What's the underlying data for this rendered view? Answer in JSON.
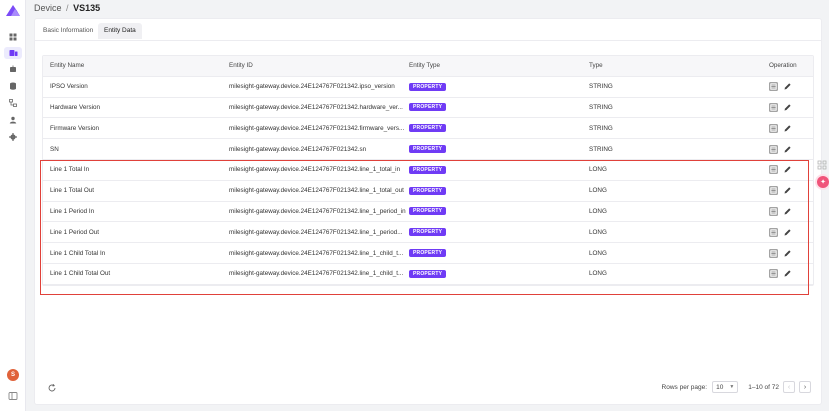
{
  "brand": {
    "accent": "#6f3bf5",
    "highlight": "#e0413a"
  },
  "nav": {
    "items": [
      {
        "icon": "dashboard-icon"
      },
      {
        "icon": "device-icon",
        "active": true
      },
      {
        "icon": "gateway-icon"
      },
      {
        "icon": "database-icon"
      },
      {
        "icon": "workflow-icon"
      },
      {
        "icon": "user-icon"
      },
      {
        "icon": "settings-icon"
      }
    ],
    "avatar_initial": "S"
  },
  "breadcrumb": {
    "parent": "Device",
    "separator": "/",
    "current": "VS135"
  },
  "tabs": [
    {
      "label": "Basic Information",
      "active": false
    },
    {
      "label": "Entity Data",
      "active": true
    }
  ],
  "table": {
    "columns": {
      "name": "Entity Name",
      "id": "Entity ID",
      "entity_type": "Entity Type",
      "type": "Type",
      "operation": "Operation"
    },
    "rows": [
      {
        "name": "IPSO Version",
        "id": "milesight-gateway.device.24E124767F021342.ipso_version",
        "entity_type": "PROPERTY",
        "type": "STRING"
      },
      {
        "name": "Hardware Version",
        "id": "milesight-gateway.device.24E124767F021342.hardware_ver...",
        "entity_type": "PROPERTY",
        "type": "STRING"
      },
      {
        "name": "Firmware Version",
        "id": "milesight-gateway.device.24E124767F021342.firmware_vers...",
        "entity_type": "PROPERTY",
        "type": "STRING"
      },
      {
        "name": "SN",
        "id": "milesight-gateway.device.24E124767F021342.sn",
        "entity_type": "PROPERTY",
        "type": "STRING"
      },
      {
        "name": "Line 1 Total In",
        "id": "milesight-gateway.device.24E124767F021342.line_1_total_in",
        "entity_type": "PROPERTY",
        "type": "LONG"
      },
      {
        "name": "Line 1 Total Out",
        "id": "milesight-gateway.device.24E124767F021342.line_1_total_out",
        "entity_type": "PROPERTY",
        "type": "LONG"
      },
      {
        "name": "Line 1 Period In",
        "id": "milesight-gateway.device.24E124767F021342.line_1_period_in",
        "entity_type": "PROPERTY",
        "type": "LONG"
      },
      {
        "name": "Line 1 Period Out",
        "id": "milesight-gateway.device.24E124767F021342.line_1_period...",
        "entity_type": "PROPERTY",
        "type": "LONG"
      },
      {
        "name": "Line 1 Child Total In",
        "id": "milesight-gateway.device.24E124767F021342.line_1_child_t...",
        "entity_type": "PROPERTY",
        "type": "LONG"
      },
      {
        "name": "Line 1 Child Total Out",
        "id": "milesight-gateway.device.24E124767F021342.line_1_child_t...",
        "entity_type": "PROPERTY",
        "type": "LONG"
      }
    ]
  },
  "pagination": {
    "rows_per_page_label": "Rows per page:",
    "rows_per_page": "10",
    "range": "1–10 of 72"
  }
}
